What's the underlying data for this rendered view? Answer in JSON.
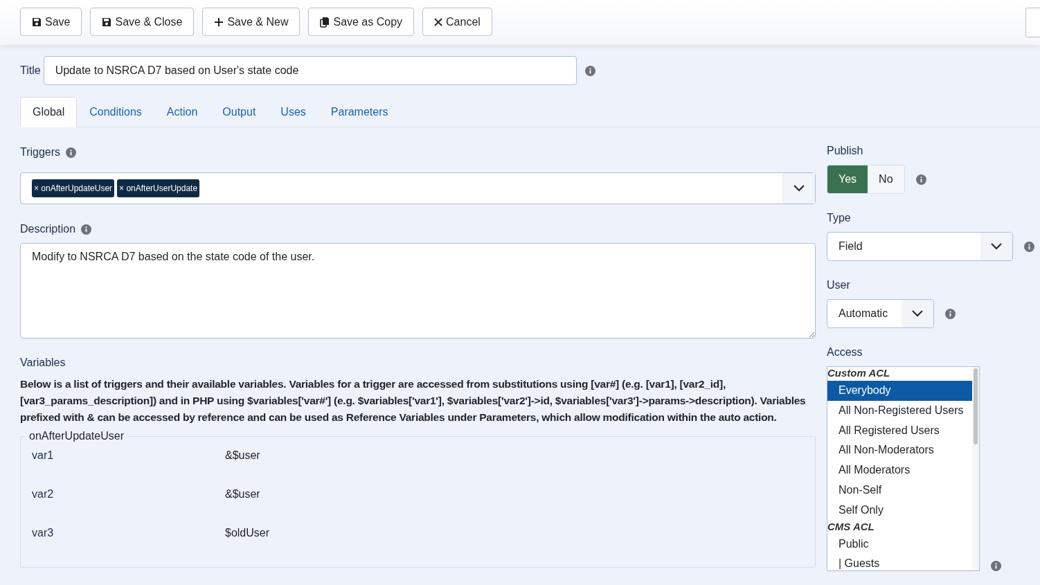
{
  "toolbar": {
    "buttons": [
      {
        "label": "Save",
        "kind": "save"
      },
      {
        "label": "Save & Close",
        "kind": "save"
      },
      {
        "label": "Save & New",
        "kind": "new"
      },
      {
        "label": "Save as Copy",
        "kind": "copy"
      },
      {
        "label": "Cancel",
        "kind": "cancel"
      }
    ]
  },
  "title_field": {
    "label": "Title",
    "value": "Update to NSRCA D7 based on User's state code"
  },
  "tabs": [
    {
      "label": "Global",
      "selected": true
    },
    {
      "label": "Conditions",
      "selected": false
    },
    {
      "label": "Action",
      "selected": false
    },
    {
      "label": "Output",
      "selected": false
    },
    {
      "label": "Uses",
      "selected": false
    },
    {
      "label": "Parameters",
      "selected": false
    }
  ],
  "triggers": {
    "label": "Triggers",
    "tags": [
      {
        "remove": "×",
        "label": "onAfterUpdateUser"
      },
      {
        "remove": "×",
        "label": "onAfterUserUpdate"
      }
    ]
  },
  "description": {
    "label": "Description",
    "value": "Modify to NSRCA D7 based on the state code of the user."
  },
  "variables": {
    "label": "Variables",
    "help": "Below is a list of triggers and their available variables. Variables for a trigger are accessed from substitutions using [var#] (e.g. [var1], [var2_id], [var3_params_description]) and in PHP using $variables['var#'] (e.g. $variables['var1'], $variables['var2']->id, $variables['var3']->params->description). Variables prefixed with & can be accessed by reference and can be used as Reference Variables under Parameters, which allow modification within the auto action.",
    "groups": [
      {
        "trigger": "onAfterUpdateUser",
        "rows": [
          {
            "name": "var1",
            "value": "&$user"
          },
          {
            "name": "var2",
            "value": "&$user"
          },
          {
            "name": "var3",
            "value": "$oldUser"
          }
        ]
      }
    ]
  },
  "publish": {
    "label": "Publish",
    "options": [
      {
        "label": "Yes",
        "selected": true
      },
      {
        "label": "No",
        "selected": false
      }
    ]
  },
  "type": {
    "label": "Type",
    "value": "Field"
  },
  "user": {
    "label": "User",
    "value": "Automatic"
  },
  "access": {
    "label": "Access",
    "items": [
      {
        "kind": "group",
        "label": "Custom ACL"
      },
      {
        "kind": "option",
        "label": "Everybody",
        "selected": true
      },
      {
        "kind": "option",
        "label": "All Non-Registered Users",
        "selected": false
      },
      {
        "kind": "option",
        "label": "All Registered Users",
        "selected": false
      },
      {
        "kind": "option",
        "label": "All Non-Moderators",
        "selected": false
      },
      {
        "kind": "option",
        "label": "All Moderators",
        "selected": false
      },
      {
        "kind": "option",
        "label": "Non-Self",
        "selected": false
      },
      {
        "kind": "option",
        "label": "Self Only",
        "selected": false
      },
      {
        "kind": "group",
        "label": "CMS ACL"
      },
      {
        "kind": "option",
        "label": "Public",
        "selected": false
      },
      {
        "kind": "option",
        "label": "| Guests",
        "selected": false
      }
    ]
  }
}
